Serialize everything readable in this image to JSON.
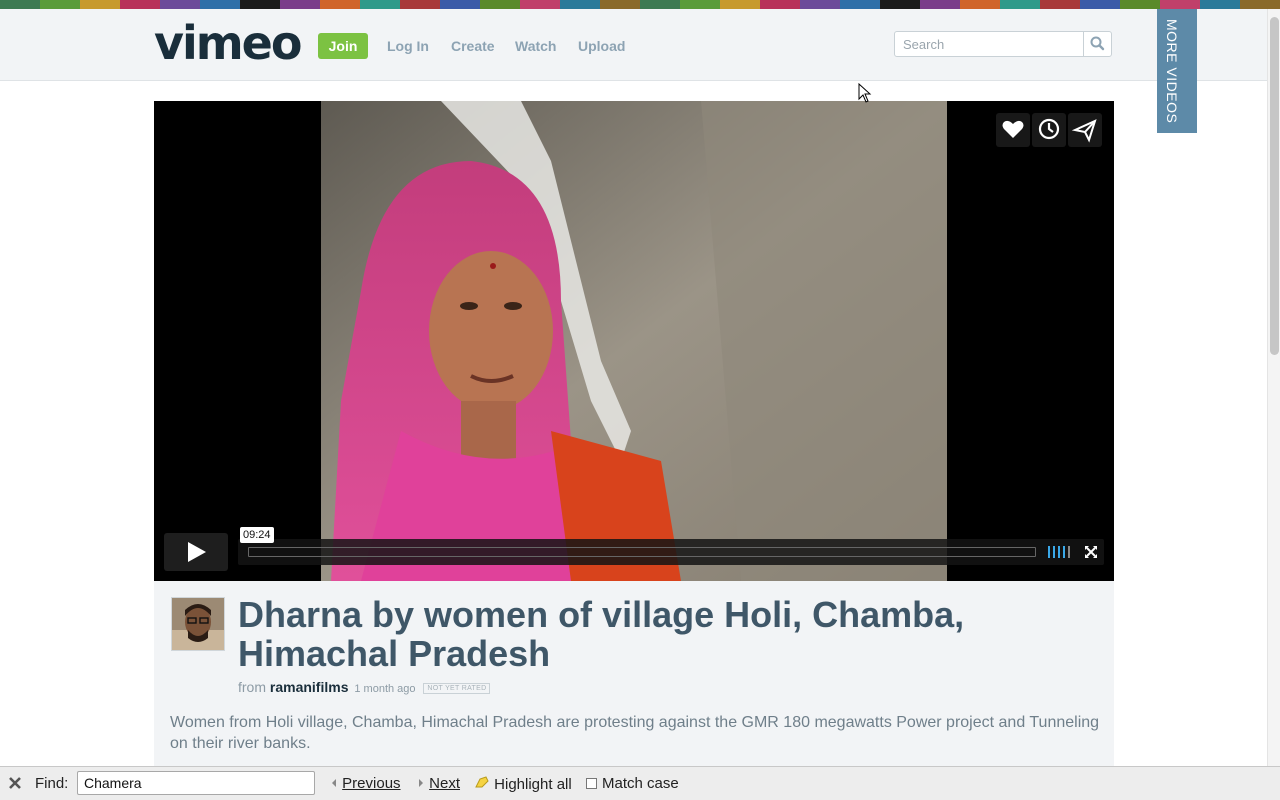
{
  "header": {
    "logo": "vimeo",
    "join_label": "Join",
    "nav": [
      {
        "label": "Log In"
      },
      {
        "label": "Create"
      },
      {
        "label": "Watch"
      },
      {
        "label": "Upload"
      }
    ],
    "search_placeholder": "Search",
    "more_videos_label": "MORE VIDEOS"
  },
  "player": {
    "time_label": "09:24",
    "progress_fraction": 0.0,
    "side_buttons": [
      "heart-icon",
      "clock-icon",
      "send-icon"
    ]
  },
  "video": {
    "title": "Dharna by women of village Holi, Chamba, Himachal Pradesh",
    "from_label": "from",
    "uploader": "ramanifilms",
    "uploaded_ago": "1 month ago",
    "rating_badge": "NOT YET RATED",
    "description": "Women from Holi village, Chamba, Himachal Pradesh are protesting against the GMR 180 megawatts Power project and Tunneling on their river banks."
  },
  "findbar": {
    "label": "Find:",
    "value": "Chamera",
    "previous_label": "Previous",
    "next_label": "Next",
    "highlight_label": "Highlight all",
    "match_case_label": "Match case"
  },
  "colors": {
    "accent_green": "#7cc242",
    "nav_text": "#8da3b3",
    "title_text": "#3f5768",
    "more_videos_bg": "#5d8aa8"
  }
}
